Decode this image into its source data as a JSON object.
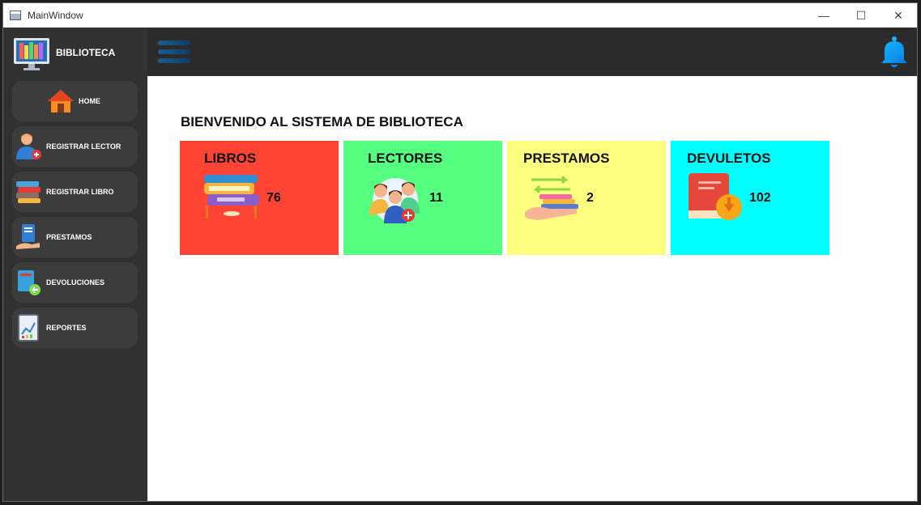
{
  "window": {
    "title": "MainWindow",
    "controls": {
      "minimize": "—",
      "maximize": "☐",
      "close": "✕"
    }
  },
  "brand": {
    "name": "BIBLIOTECA"
  },
  "sidebar": {
    "items": [
      {
        "label": "HOME",
        "icon": "home-icon"
      },
      {
        "label": "REGISTRAR LECTOR",
        "icon": "add-reader-icon"
      },
      {
        "label": "REGISTRAR LIBRO",
        "icon": "books-stack-icon"
      },
      {
        "label": "PRESTAMOS",
        "icon": "book-loan-icon"
      },
      {
        "label": "DEVOLUCIONES",
        "icon": "book-return-icon"
      },
      {
        "label": "REPORTES",
        "icon": "report-chart-icon"
      }
    ]
  },
  "main": {
    "welcome": "BIENVENIDO AL SISTEMA DE BIBLIOTECA",
    "cards": [
      {
        "label": "LIBROS",
        "count": "76",
        "color": "#ff4433"
      },
      {
        "label": "LECTORES",
        "count": "11",
        "color": "#55ff7f"
      },
      {
        "label": "PRESTAMOS",
        "count": "2",
        "color": "#ffff7f"
      },
      {
        "label": "DEVULETOS",
        "count": "102",
        "color": "#00ffff"
      }
    ]
  },
  "icons": {
    "menu": "hamburger-menu-icon",
    "notifications": "bell-icon"
  }
}
